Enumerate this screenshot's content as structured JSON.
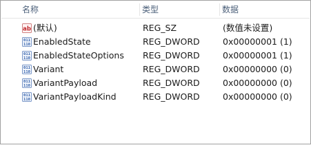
{
  "columns": {
    "name": "名称",
    "type": "类型",
    "data": "数据"
  },
  "rows": [
    {
      "icon": "string-value-icon",
      "name": "(默认)",
      "type": "REG_SZ",
      "data": "(数值未设置)"
    },
    {
      "icon": "binary-value-icon",
      "name": "EnabledState",
      "type": "REG_DWORD",
      "data": "0x00000001 (1)"
    },
    {
      "icon": "binary-value-icon",
      "name": "EnabledStateOptions",
      "type": "REG_DWORD",
      "data": "0x00000001 (1)"
    },
    {
      "icon": "binary-value-icon",
      "name": "Variant",
      "type": "REG_DWORD",
      "data": "0x00000000 (0)"
    },
    {
      "icon": "binary-value-icon",
      "name": "VariantPayload",
      "type": "REG_DWORD",
      "data": "0x00000000 (0)"
    },
    {
      "icon": "binary-value-icon",
      "name": "VariantPayloadKind",
      "type": "REG_DWORD",
      "data": "0x00000000 (0)"
    }
  ],
  "colors": {
    "header_text": "#4c607a",
    "string_icon": "#c0282d",
    "binary_icon": "#2a5aa8"
  }
}
